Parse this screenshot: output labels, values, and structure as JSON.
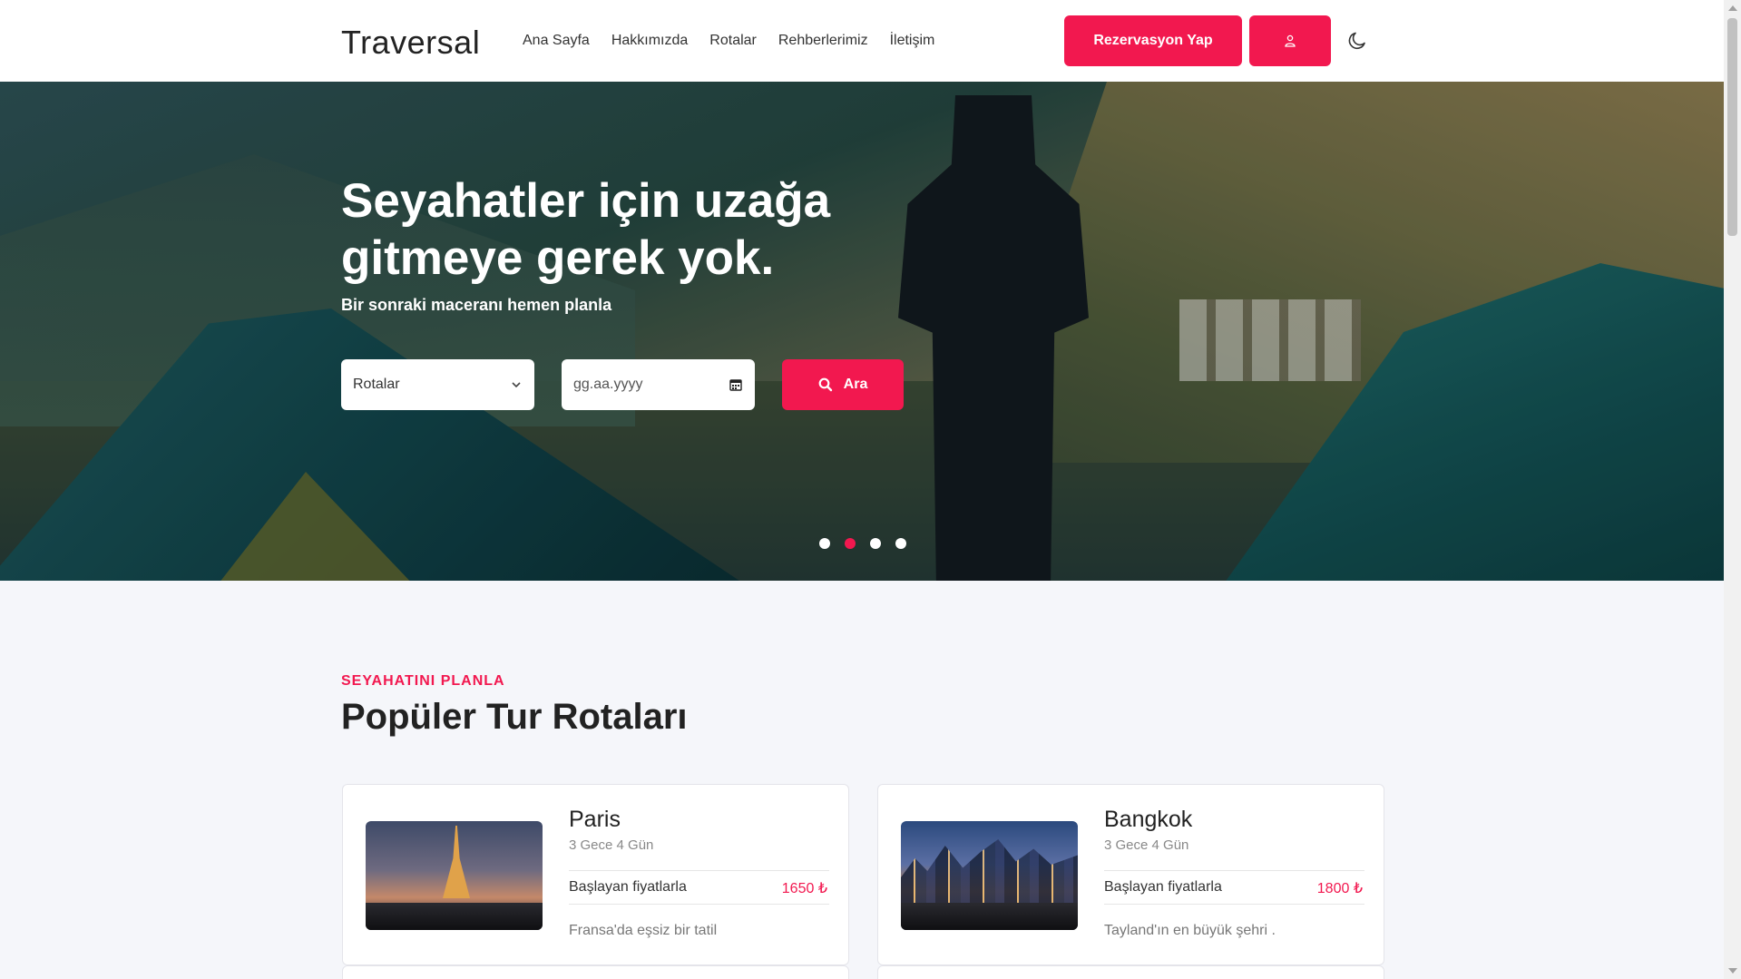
{
  "header": {
    "logo": "Traversal",
    "nav": [
      "Ana Sayfa",
      "Hakkımızda",
      "Rotalar",
      "Rehberlerimiz",
      "İletişim"
    ],
    "reservation_label": "Rezervasyon Yap",
    "user_icon": "user-icon",
    "theme_icon": "moon-icon"
  },
  "hero": {
    "title": "Seyahatler için uzağa gitmeye gerek yok.",
    "subtitle": "Bir sonraki maceranı hemen planla",
    "route_select": "Rotalar",
    "date_placeholder": "gg.aa.yyyy",
    "search_label": "Ara",
    "slides": 4,
    "active_slide": 2
  },
  "section": {
    "eyebrow": "SEYAHATINI PLANLA",
    "title": "Popüler Tur Rotaları"
  },
  "tours": [
    {
      "name": "Paris",
      "duration": "3 Gece 4 Gün",
      "price_label": "Başlayan fiyatlarla",
      "price": "1650 ₺",
      "description": "Fransa'da eşsiz bir tatil"
    },
    {
      "name": "Bangkok",
      "duration": "3 Gece 4 Gün",
      "price_label": "Başlayan fiyatlarla",
      "price": "1800 ₺",
      "description": "Tayland'ın en büyük şehri ."
    }
  ],
  "colors": {
    "accent": "#f2184f",
    "background": "#f5f6fa"
  }
}
